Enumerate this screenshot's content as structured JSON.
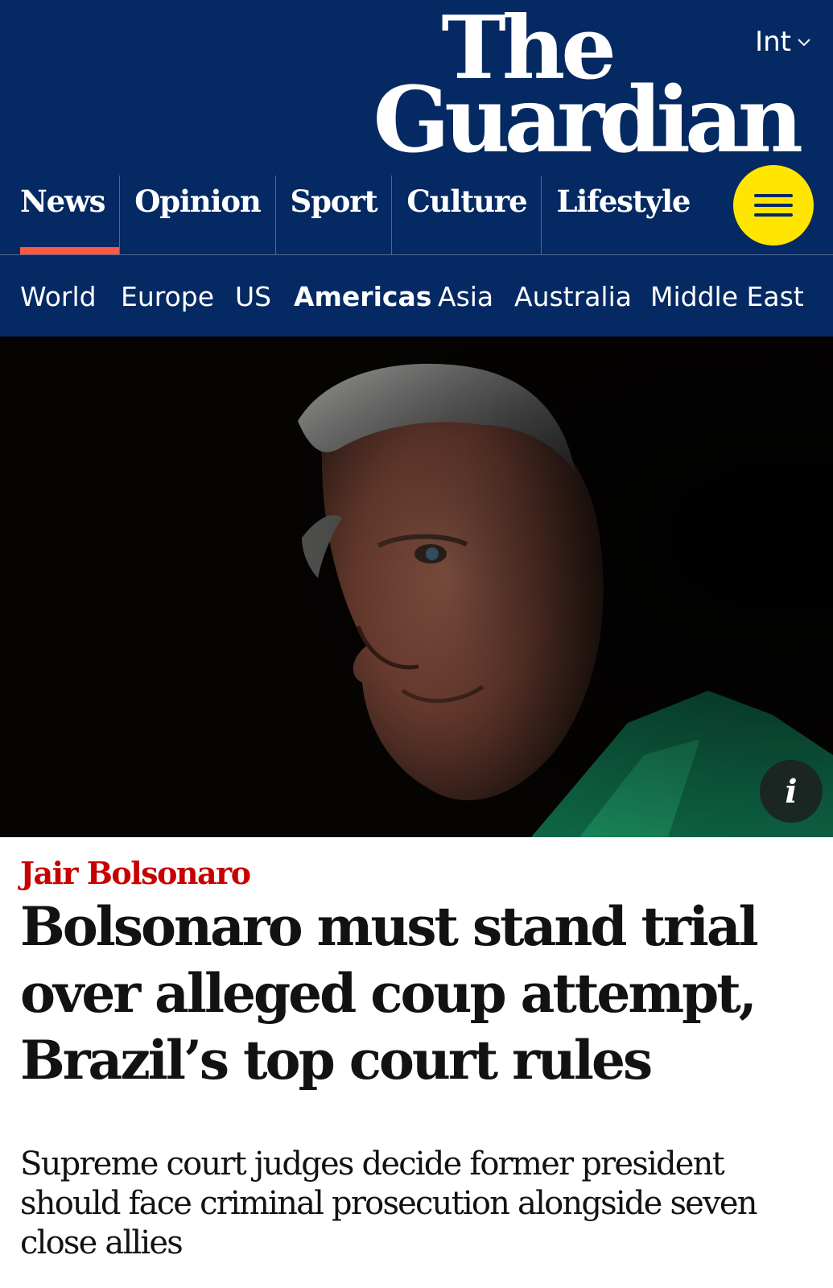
{
  "masthead": {
    "edition": "Int",
    "logo_line1": "The",
    "logo_line2": "Guardian",
    "background": "#052962",
    "accent": "#ff5943"
  },
  "pillars": [
    {
      "label": "News",
      "active": true
    },
    {
      "label": "Opinion",
      "active": false
    },
    {
      "label": "Sport",
      "active": false
    },
    {
      "label": "Culture",
      "active": false
    },
    {
      "label": "Lifestyle",
      "active": false
    }
  ],
  "menu": {
    "icon": "hamburger-icon",
    "color": "#ffe500"
  },
  "subnav": [
    {
      "label": "World",
      "active": false
    },
    {
      "label": "Europe",
      "active": false
    },
    {
      "label": "US",
      "active": false
    },
    {
      "label": "Americas",
      "active": true
    },
    {
      "label": "Asia",
      "active": false
    },
    {
      "label": "Australia",
      "active": false
    },
    {
      "label": "Middle East",
      "active": false
    }
  ],
  "hero": {
    "info_icon": "i"
  },
  "article": {
    "kicker": "Jair Bolsonaro",
    "kicker_color": "#c70000",
    "headline_line1": "Bolsonaro must stand trial",
    "headline_line2": "over alleged coup attempt,",
    "headline_line3": "Brazil’s top court rules",
    "standfirst_line1": "Supreme court judges decide former president",
    "standfirst_line2": "should face criminal prosecution alongside seven",
    "standfirst_line3": "close allies"
  }
}
